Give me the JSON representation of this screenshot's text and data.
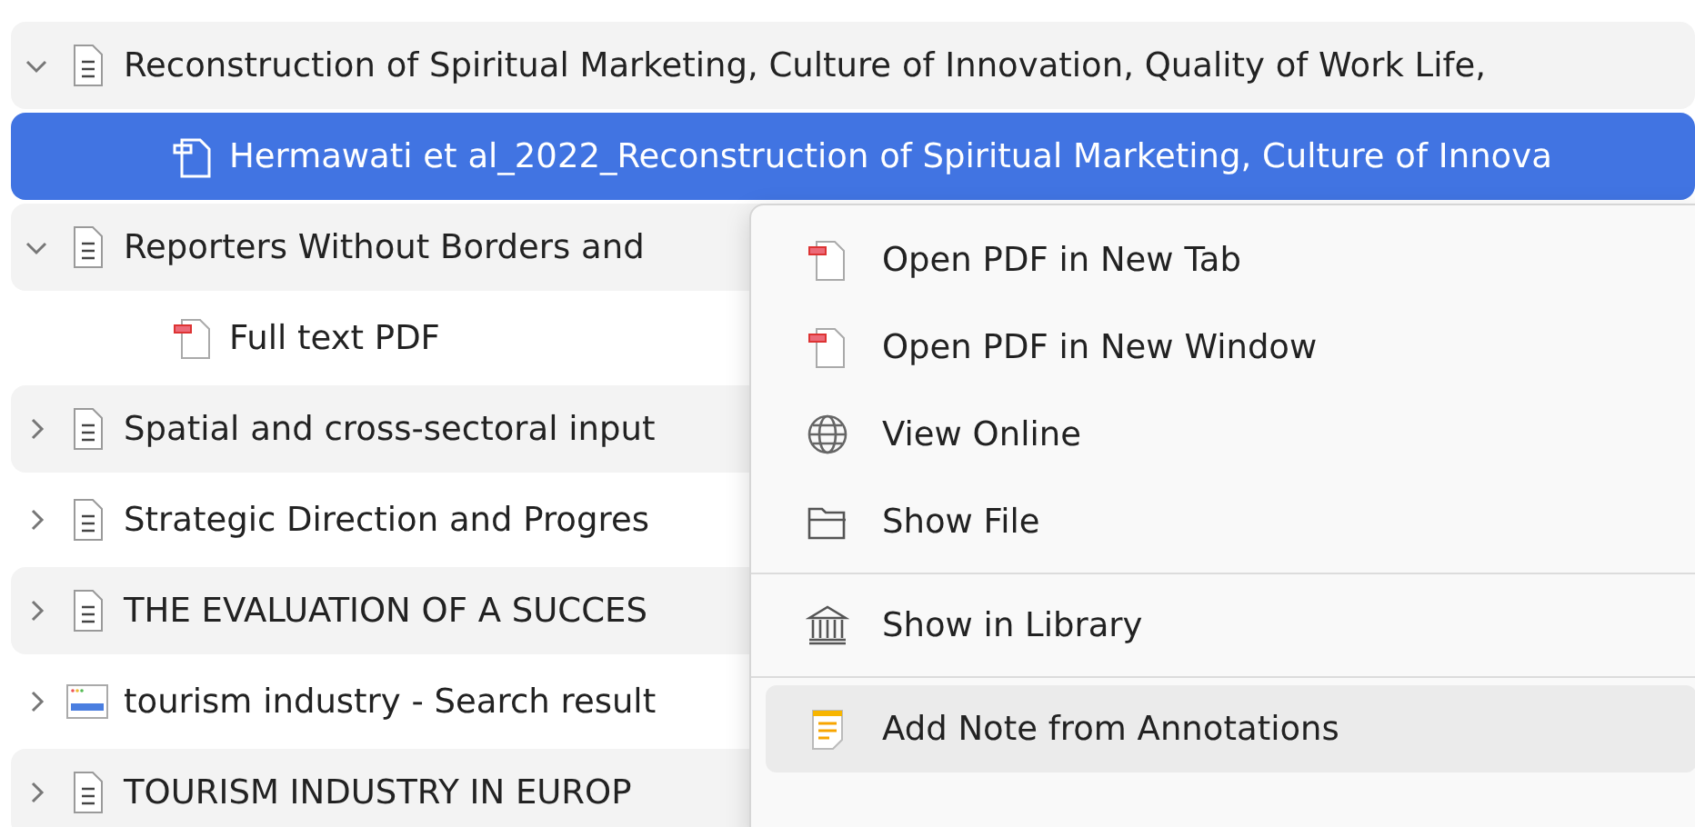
{
  "tree": [
    {
      "title": "Reconstruction of Spiritual Marketing, Culture of Innovation, Quality of Work Life,",
      "kind": "document",
      "expanded": true,
      "selected": false,
      "children": [
        {
          "title": "Hermawati et al_2022_Reconstruction of Spiritual Marketing, Culture of Innova",
          "kind": "attachment",
          "selected": true
        }
      ]
    },
    {
      "title": "Reporters Without Borders and",
      "kind": "document",
      "expanded": true,
      "selected": false,
      "children": [
        {
          "title": "Full text PDF",
          "kind": "pdf",
          "selected": false
        }
      ]
    },
    {
      "title": "Spatial and cross-sectoral input",
      "kind": "document",
      "expanded": false,
      "selected": false
    },
    {
      "title": "Strategic Direction and Progres",
      "kind": "document",
      "expanded": false,
      "selected": false
    },
    {
      "title": "THE EVALUATION OF A SUCCES",
      "kind": "document",
      "expanded": false,
      "selected": false
    },
    {
      "title": "tourism industry - Search result",
      "kind": "webpage",
      "expanded": false,
      "selected": false
    },
    {
      "title": "TOURISM INDUSTRY IN EUROP",
      "kind": "document",
      "expanded": false,
      "selected": false
    }
  ],
  "context_menu": {
    "groups": [
      [
        {
          "label": "Open PDF in New Tab",
          "kind": "pdf",
          "selected": false
        },
        {
          "label": "Open PDF in New Window",
          "kind": "pdf",
          "selected": false
        },
        {
          "label": "View Online",
          "kind": "globe",
          "selected": false
        },
        {
          "label": "Show File",
          "kind": "folder",
          "selected": false
        }
      ],
      [
        {
          "label": "Show in Library",
          "kind": "library",
          "selected": false
        }
      ],
      [
        {
          "label": "Add Note from Annotations",
          "kind": "note",
          "selected": true
        }
      ]
    ]
  }
}
